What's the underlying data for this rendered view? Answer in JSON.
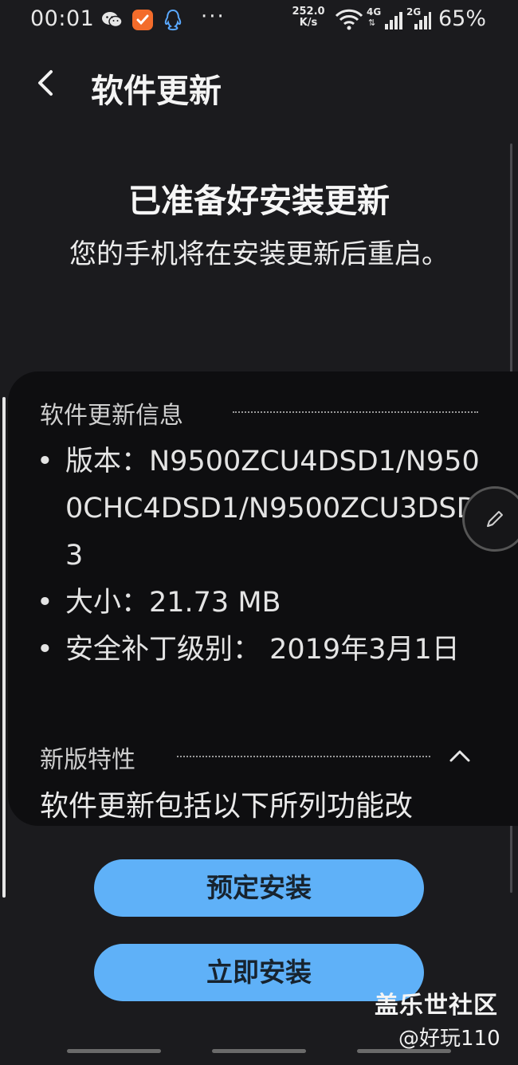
{
  "status_bar": {
    "time": "00:01",
    "icons": [
      "wechat-icon",
      "notification-app-icon",
      "qq-icon"
    ],
    "more": "···",
    "net_speed_value": "252.0",
    "net_speed_unit": "K/s",
    "signal_4g": "4G",
    "signal_2g": "2G",
    "battery": "65%"
  },
  "header": {
    "title": "软件更新"
  },
  "headline": {
    "title": "已准备好安装更新",
    "subtitle": "您的手机将在安装更新后重启。"
  },
  "info": {
    "section_title": "软件更新信息",
    "items": [
      "版本：N9500ZCU4DSD1/N9500CHC4DSD1/N9500ZCU3DSD3",
      "大小：21.73 MB",
      "安全补丁级别： 2019年3月1日"
    ]
  },
  "features": {
    "section_title": "新版特性",
    "text": "软件更新包括以下所列功能改"
  },
  "actions": {
    "schedule": "预定安装",
    "install_now": "立即安装"
  },
  "watermark": {
    "site": "盖乐世社区",
    "user": "@好玩110"
  },
  "colors": {
    "background": "#1b1b1e",
    "card": "#0e0e10",
    "button": "#5fb1f8",
    "button_text": "#17232e"
  }
}
